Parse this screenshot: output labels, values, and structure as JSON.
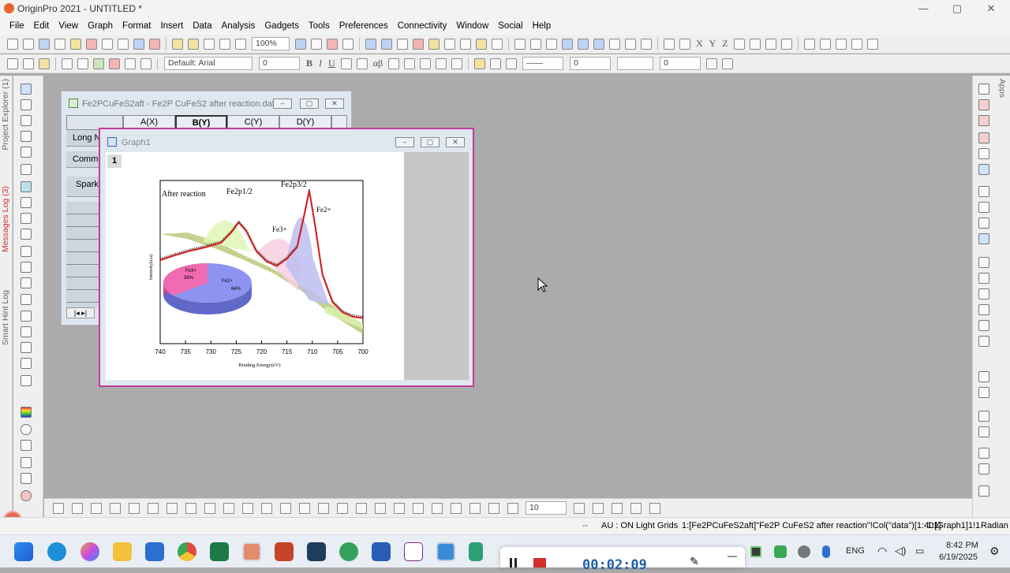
{
  "app": {
    "title": "OriginPro 2021 - UNTITLED *",
    "window_controls": [
      "—",
      "▢",
      "✕"
    ]
  },
  "menu": [
    "File",
    "Edit",
    "View",
    "Graph",
    "Format",
    "Insert",
    "Data",
    "Analysis",
    "Gadgets",
    "Tools",
    "Preferences",
    "Connectivity",
    "Window",
    "Social",
    "Help"
  ],
  "toolbar": {
    "zoom": "100%",
    "font": "Default: Arial",
    "font_size": "0",
    "bold": "B",
    "italic": "I",
    "underline": "U",
    "greek": "αβ",
    "line_width": "0",
    "pattern_size": "0",
    "xyz": [
      "X",
      "Y",
      "Z"
    ],
    "bottom_size": "10"
  },
  "left_dock": [
    "Project Explorer (1)",
    "Messages Log (3)",
    "Smart Hint Log"
  ],
  "right_dock": [
    "Apps"
  ],
  "worksheet": {
    "title": "Fe2PCuFeS2aft - Fe2P CuFeS2 after reaction.dat",
    "columns": [
      "A(X)",
      "B(Y)",
      "C(Y)",
      "D(Y)"
    ],
    "row_headers": [
      "Long N",
      "Comm",
      "Spark"
    ]
  },
  "graph_window": {
    "title": "Graph1",
    "layer": "1"
  },
  "chart_data": {
    "type": "line",
    "title": "",
    "xlabel": "Binding Energy(eV)",
    "ylabel": "Intensity(a.u)",
    "xlim": [
      740,
      700
    ],
    "x_ticks": [
      740,
      735,
      730,
      725,
      720,
      715,
      710,
      705,
      700
    ],
    "reversed_x": true,
    "annotations": [
      "After reaction",
      "Fe2p1/2",
      "Fe2p3/2",
      "Fe3+",
      "Fe2+"
    ],
    "series": [
      {
        "name": "",
        "x": [
          740,
          737,
          734,
          731,
          728,
          726,
          724.5,
          723,
          721,
          719,
          717,
          715,
          713,
          711.5,
          710.6,
          709.5,
          708,
          706,
          704,
          702,
          700
        ],
        "values": [
          100,
          107,
          113,
          118,
          124,
          138,
          152,
          140,
          112,
          98,
          92,
          102,
          118,
          165,
          196,
          150,
          80,
          42,
          28,
          22,
          20
        ]
      }
    ],
    "inset_pie": {
      "type": "pie",
      "labels": [
        "Fe3+",
        "Fe2+"
      ],
      "values": [
        36,
        64
      ],
      "value_labels": [
        "36%",
        "64%"
      ],
      "colors": [
        "#f06bb1",
        "#8e93f2"
      ]
    }
  },
  "status": {
    "dots": "--",
    "au": "AU : ON",
    "grids": "Light Grids",
    "book": "1:[Fe2PCuFeS2aft]\"Fe2P CuFeS2 after reaction\"!Col(\"data\")[1:401]",
    "graph": "1:[Graph1]1!1",
    "angle": "Radian"
  },
  "taskbar": {
    "recording_time": "00:02:09",
    "language": "ENG",
    "time": "8:42 PM",
    "date": "6/19/2025"
  },
  "colors": {
    "graph_border": "#c23b9a",
    "workspace": "#ababab",
    "fit_curve": "#d21e1e"
  }
}
